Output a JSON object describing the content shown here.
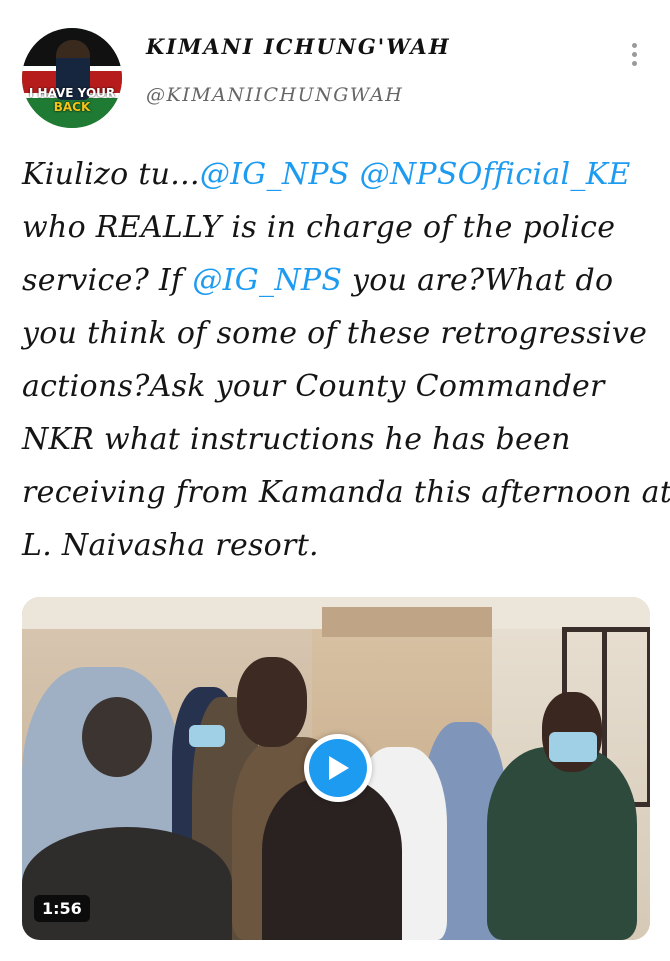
{
  "header": {
    "display_name": "KIMANI ICHUNG'WAH",
    "handle": "@KIMANIICHUNGWAH",
    "avatar_slogan_1": "I HAVE YOUR",
    "avatar_slogan_2": "BACK"
  },
  "tweet": {
    "lines": [
      [
        {
          "t": "Kiulizo tu...",
          "m": false
        },
        {
          "t": "@IG_NPS",
          "m": true
        },
        {
          "t": " ",
          "m": false
        },
        {
          "t": "@NPSOfficial_KE",
          "m": true
        }
      ],
      [
        {
          "t": "who REALLY is in charge of the police",
          "m": false
        }
      ],
      [
        {
          "t": "service? If ",
          "m": false
        },
        {
          "t": "@IG_NPS",
          "m": true
        },
        {
          "t": " you are?What do",
          "m": false
        }
      ],
      [
        {
          "t": "you think of some of these retrogressive",
          "m": false
        }
      ],
      [
        {
          "t": "actions?Ask your County Commander",
          "m": false
        }
      ],
      [
        {
          "t": "NKR what instructions he has been",
          "m": false
        }
      ],
      [
        {
          "t": "receiving from Kamanda this afternoon at",
          "m": false
        }
      ],
      [
        {
          "t": "L. Naivasha resort.",
          "m": false
        }
      ]
    ]
  },
  "media": {
    "duration": "1:56",
    "play_icon": "play-icon"
  },
  "colors": {
    "mention": "#1d9bf0",
    "play_button": "#1d9bf0"
  }
}
